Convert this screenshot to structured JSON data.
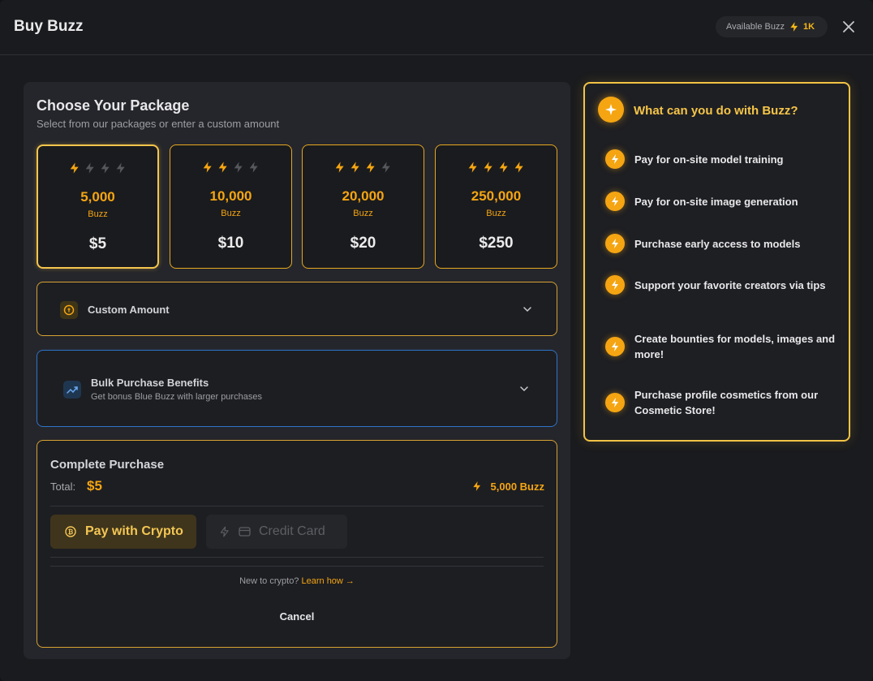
{
  "header": {
    "title": "Buy Buzz",
    "available_label": "Available Buzz",
    "available_amount": "1K"
  },
  "package_section": {
    "title": "Choose Your Package",
    "subtitle": "Select from our packages or enter a custom amount",
    "packages": [
      {
        "amount": "5,000",
        "unit": "Buzz",
        "price": "$5",
        "filled_bolts": 1,
        "selected": true
      },
      {
        "amount": "10,000",
        "unit": "Buzz",
        "price": "$10",
        "filled_bolts": 2,
        "selected": false
      },
      {
        "amount": "20,000",
        "unit": "Buzz",
        "price": "$20",
        "filled_bolts": 3,
        "selected": false
      },
      {
        "amount": "250,000",
        "unit": "Buzz",
        "price": "$250",
        "filled_bolts": 4,
        "selected": false
      }
    ]
  },
  "custom_amount": {
    "label": "Custom Amount"
  },
  "bulk": {
    "label": "Bulk Purchase Benefits",
    "sublabel": "Get bonus Blue Buzz with larger purchases"
  },
  "purchase": {
    "title": "Complete Purchase",
    "total_label": "Total:",
    "total_value": "$5",
    "buzz_amount": "5,000 Buzz",
    "crypto_label": "Pay with Crypto",
    "card_label": "Credit Card",
    "new_to_crypto": "New to crypto?",
    "learn_how": "Learn how →",
    "cancel_label": "Cancel"
  },
  "benefits": {
    "title": "What can you do with Buzz?",
    "items": [
      "Pay for on-site model training",
      "Pay for on-site image generation",
      "Purchase early access to models",
      "Support your favorite creators via tips",
      "Create bounties for models, images and more!",
      "Purchase profile cosmetics from our Cosmetic Store!"
    ]
  },
  "colors": {
    "accent": "#f5a512",
    "accent_light": "#f6c548",
    "blue_border": "#2f74c8",
    "background": "#1a1b1e"
  },
  "icons": [
    "lightning-icon",
    "close-icon",
    "chevron-down-icon",
    "coin-icon",
    "trend-up-icon",
    "bitcoin-icon",
    "credit-card-icon",
    "sparkle-icon"
  ]
}
